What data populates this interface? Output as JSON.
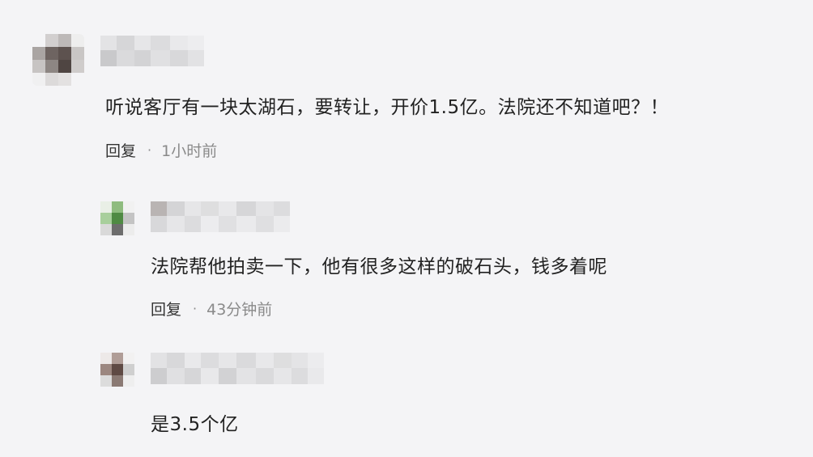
{
  "comments": [
    {
      "text": "听说客厅有一块太湖石，要转让，开价1.5亿。法院还不知道吧？！",
      "reply_label": "回复",
      "separator": "·",
      "time": "1小时前"
    },
    {
      "text": "法院帮他拍卖一下，他有很多这样的破石头，钱多着呢",
      "reply_label": "回复",
      "separator": "·",
      "time": "43分钟前"
    },
    {
      "text": "是3.5个亿"
    }
  ],
  "colors": {
    "background": "#f4f4f6",
    "text": "#222222",
    "meta": "#8a8a8a"
  }
}
